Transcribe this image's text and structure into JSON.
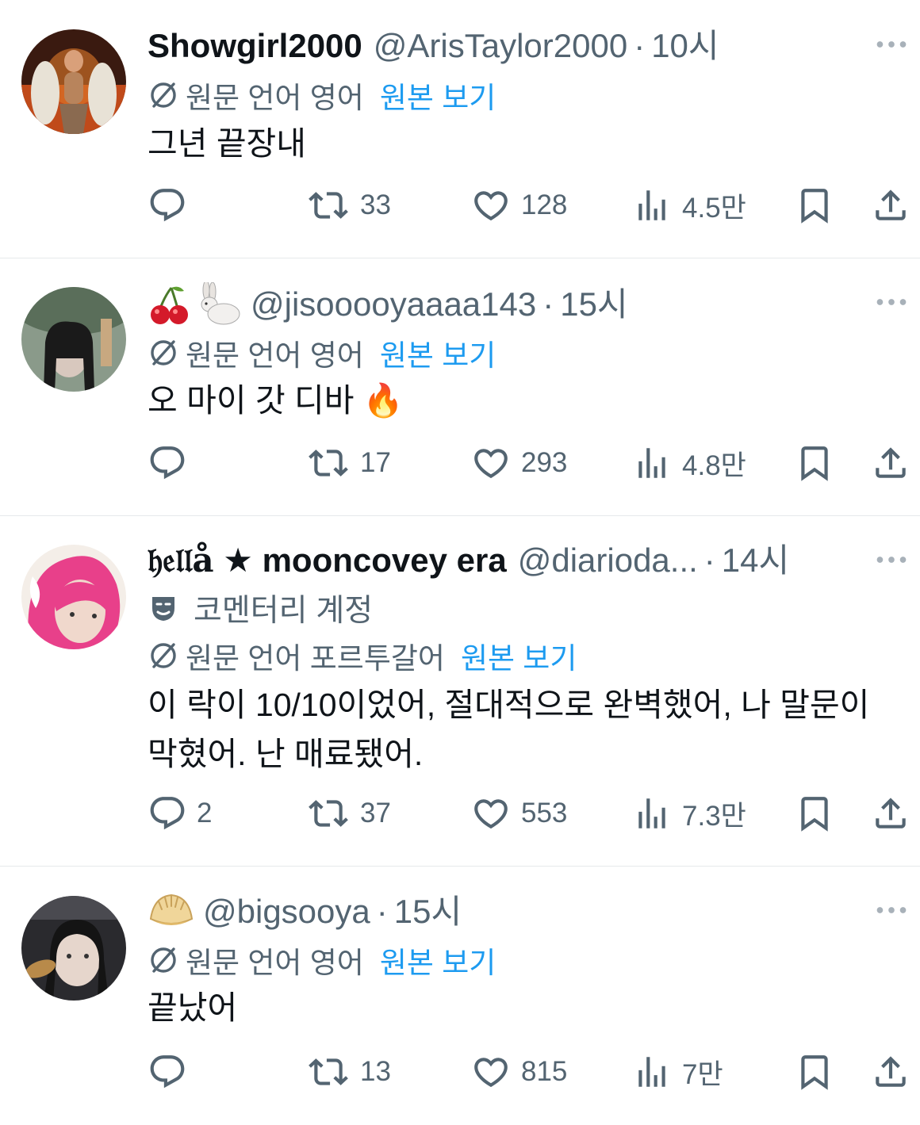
{
  "translate": {
    "label_prefix": "원문 언어",
    "link": "원본 보기"
  },
  "tweets": [
    {
      "display_name": "Showgirl2000",
      "handle": "@ArisTaylor2000",
      "sep": "·",
      "time": "10시",
      "source_language": "영어",
      "text": "그년 끝장내",
      "replies": "",
      "retweets": "33",
      "likes": "128",
      "views": "4.5만"
    },
    {
      "emoji_name": "🍒🐇",
      "handle": "@jisooooyaaaa143",
      "sep": "·",
      "time": "15시",
      "source_language": "영어",
      "text": "오 마이 갓 디바 🔥",
      "replies": "",
      "retweets": "17",
      "likes": "293",
      "views": "4.8만"
    },
    {
      "display_name_prefix": "𝔥𝔢𝔩𝔩å",
      "display_name": "★ mooncovey era",
      "handle": "@diarioda...",
      "sep": "·",
      "time": "14시",
      "commentary": "코멘터리 계정",
      "source_language": "포르투갈어",
      "text": "이 락이 10/10이었어, 절대적으로 완벽했어, 나 말문이 막혔어. 난 매료됐어.",
      "replies": "2",
      "retweets": "37",
      "likes": "553",
      "views": "7.3만"
    },
    {
      "emoji_name": "🥟",
      "handle": "@bigsooya",
      "sep": "·",
      "time": "15시",
      "source_language": "영어",
      "text": "끝났어",
      "replies": "",
      "retweets": "13",
      "likes": "815",
      "views": "7만"
    }
  ],
  "colors": {
    "text_primary": "#0f1419",
    "text_secondary": "#536471",
    "link": "#1d9bf0",
    "divider": "#e6e9eb"
  },
  "icons": [
    "translate-icon",
    "reply-icon",
    "retweet-icon",
    "like-icon",
    "views-icon",
    "bookmark-icon",
    "share-icon",
    "more-icon",
    "commentary-mask-icon"
  ]
}
